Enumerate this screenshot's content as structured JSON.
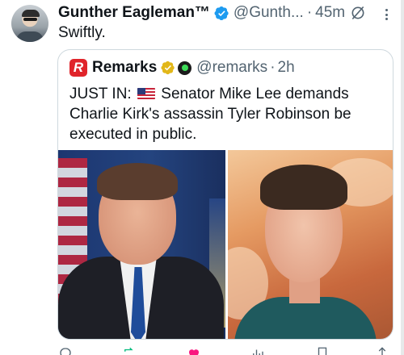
{
  "tweet": {
    "author_name": "Gunther Eagleman™",
    "author_handle": "@Gunth...",
    "separator": "·",
    "time": "45m",
    "text": "Swiftly."
  },
  "quote": {
    "logo_letter": "R",
    "author_name": "Remarks",
    "author_handle": "@remarks",
    "separator": "·",
    "time": "2h",
    "text_prefix": "JUST IN: ",
    "text_body": "Senator Mike Lee demands Charlie Kirk's assassin Tyler Robinson be executed in public."
  },
  "actions": {
    "reply_count": "",
    "repost_count": "",
    "like_count": "",
    "views_count": ""
  },
  "icons": {
    "verified": "verified-badge-icon",
    "grok": "grok-icon",
    "more": "more-options-icon",
    "flag": "us-flag-icon",
    "gold_badge": "gold-verified-icon",
    "affiliate": "affiliate-badge-icon",
    "reply": "reply-icon",
    "repost": "repost-icon",
    "like": "like-icon",
    "views": "views-icon"
  },
  "colors": {
    "verified_blue": "#1d9bf0",
    "gold_badge": "#e2b719",
    "brand_red": "#e0242a",
    "repost_green": "#00ba7c",
    "like_pink": "#f91880",
    "muted_text": "#536471"
  }
}
